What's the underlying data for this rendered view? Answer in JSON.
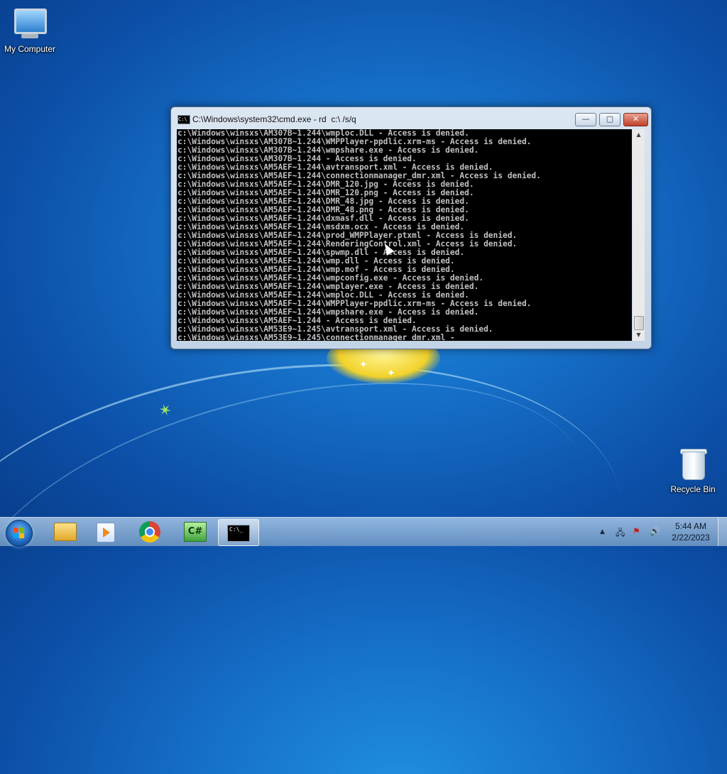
{
  "desktop": {
    "icons": [
      {
        "label": "My Computer"
      },
      {
        "label": "Recycle Bin"
      }
    ]
  },
  "window": {
    "title": "C:\\Windows\\system32\\cmd.exe - rd  c:\\ /s/q",
    "buttons": {
      "minimize": "—",
      "maximize": "▢",
      "close": "✕"
    },
    "console_lines": [
      "c:\\Windows\\winsxs\\AM307B~1.244\\wmploc.DLL - Access is denied.",
      "c:\\Windows\\winsxs\\AM307B~1.244\\WMPPlayer-ppdlic.xrm-ms - Access is denied.",
      "c:\\Windows\\winsxs\\AM307B~1.244\\wmpshare.exe - Access is denied.",
      "c:\\Windows\\winsxs\\AM307B~1.244 - Access is denied.",
      "c:\\Windows\\winsxs\\AM5AEF~1.244\\avtransport.xml - Access is denied.",
      "c:\\Windows\\winsxs\\AM5AEF~1.244\\connectionmanager_dmr.xml - Access is denied.",
      "c:\\Windows\\winsxs\\AM5AEF~1.244\\DMR_120.jpg - Access is denied.",
      "c:\\Windows\\winsxs\\AM5AEF~1.244\\DMR_120.png - Access is denied.",
      "c:\\Windows\\winsxs\\AM5AEF~1.244\\DMR_48.jpg - Access is denied.",
      "c:\\Windows\\winsxs\\AM5AEF~1.244\\DMR_48.png - Access is denied.",
      "c:\\Windows\\winsxs\\AM5AEF~1.244\\dxmasf.dll - Access is denied.",
      "c:\\Windows\\winsxs\\AM5AEF~1.244\\msdxm.ocx - Access is denied.",
      "c:\\Windows\\winsxs\\AM5AEF~1.244\\prod_WMPPlayer.ptxml - Access is denied.",
      "c:\\Windows\\winsxs\\AM5AEF~1.244\\RenderingControl.xml - Access is denied.",
      "c:\\Windows\\winsxs\\AM5AEF~1.244\\spwmp.dll - Access is denied.",
      "c:\\Windows\\winsxs\\AM5AEF~1.244\\wmp.dll - Access is denied.",
      "c:\\Windows\\winsxs\\AM5AEF~1.244\\wmp.mof - Access is denied.",
      "c:\\Windows\\winsxs\\AM5AEF~1.244\\wmpconfig.exe - Access is denied.",
      "c:\\Windows\\winsxs\\AM5AEF~1.244\\wmplayer.exe - Access is denied.",
      "c:\\Windows\\winsxs\\AM5AEF~1.244\\wmploc.DLL - Access is denied.",
      "c:\\Windows\\winsxs\\AM5AEF~1.244\\WMPPlayer-ppdlic.xrm-ms - Access is denied.",
      "c:\\Windows\\winsxs\\AM5AEF~1.244\\wmpshare.exe - Access is denied.",
      "c:\\Windows\\winsxs\\AM5AEF~1.244 - Access is denied.",
      "c:\\Windows\\winsxs\\AM53E9~1.245\\avtransport.xml - Access is denied.",
      "c:\\Windows\\winsxs\\AM53E9~1.245\\connectionmanager_dmr.xml -"
    ]
  },
  "taskbar": {
    "pinned": [
      "folder-icon",
      "media-player-icon",
      "chrome-icon",
      "csharp-icon",
      "cmd-icon"
    ],
    "cs_glyph": "C#",
    "cmd_glyph": "C:\\_",
    "clock": {
      "time": "5:44 AM",
      "date": "2/22/2023"
    },
    "tray": {
      "chevron": "▲",
      "network": "🖧",
      "flag": "⚑",
      "volume": "🔊"
    }
  }
}
